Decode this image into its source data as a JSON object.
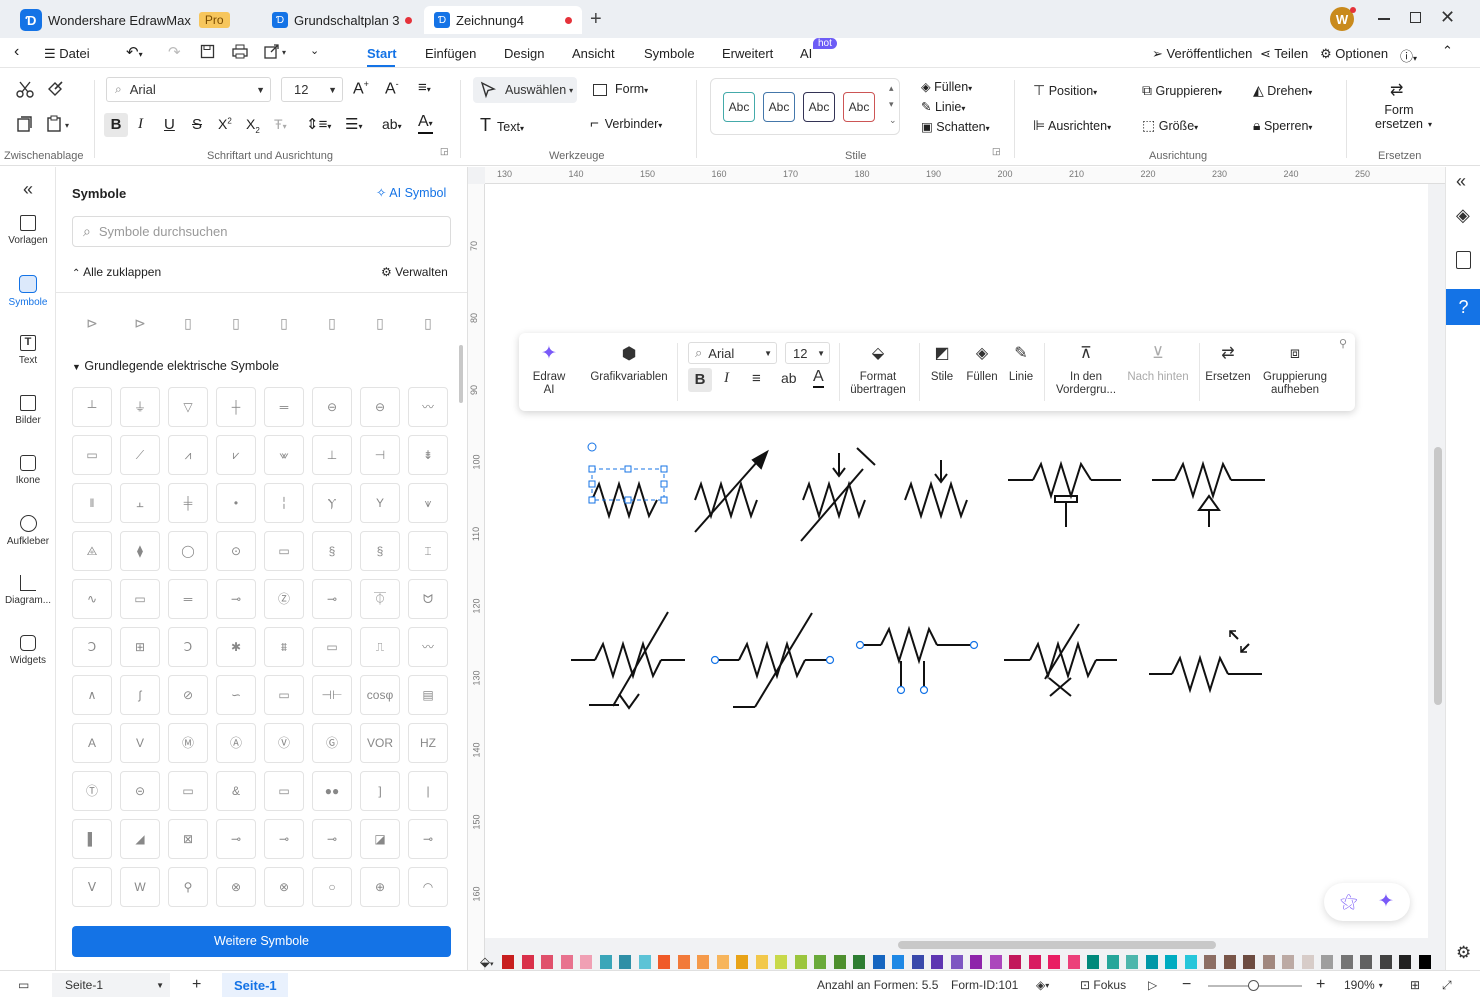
{
  "app": {
    "title": "Wondershare EdrawMax",
    "badge": "Pro",
    "tabs": [
      {
        "label": "Grundschaltplan 3"
      },
      {
        "label": "Zeichnung4"
      }
    ],
    "user_initial": "W"
  },
  "menu": {
    "file": "Datei",
    "tabs": [
      "Start",
      "Einfügen",
      "Design",
      "Ansicht",
      "Symbole",
      "Erweitert",
      "AI"
    ],
    "ai_badge": "hot",
    "publish": "Veröffentlichen",
    "share": "Teilen",
    "options": "Optionen"
  },
  "ribbon": {
    "groups": {
      "clipboard": "Zwischenablage",
      "font": "Schriftart und Ausrichtung",
      "tools": "Werkzeuge",
      "styles": "Stile",
      "align": "Ausrichtung",
      "replace": "Ersetzen"
    },
    "font_name": "Arial",
    "font_size": "12",
    "select": "Auswählen",
    "shape": "Form",
    "text": "Text",
    "connector": "Verbinder",
    "style_samples": [
      "Abc",
      "Abc",
      "Abc",
      "Abc"
    ],
    "fill": "Füllen",
    "line": "Linie",
    "shadow": "Schatten",
    "position": "Position",
    "group": "Gruppieren",
    "rotate": "Drehen",
    "align": "Ausrichten",
    "size": "Größe",
    "lock": "Sperren",
    "replace_shape": [
      "Form",
      "ersetzen"
    ]
  },
  "sidebar": {
    "items": [
      {
        "label": "Vorlagen"
      },
      {
        "label": "Symbole"
      },
      {
        "label": "Text"
      },
      {
        "label": "Bilder"
      },
      {
        "label": "Ikone"
      },
      {
        "label": "Aufkleber"
      },
      {
        "label": "Diagram..."
      },
      {
        "label": "Widgets"
      }
    ]
  },
  "symbols": {
    "title": "Symbole",
    "ai_symbol": "AI Symbol",
    "search_placeholder": "Symbole durchsuchen",
    "collapse_all": "Alle zuklappen",
    "manage": "Verwalten",
    "section": "Grundlegende elektrische Symbole",
    "more": "Weitere Symbole"
  },
  "ruler": {
    "h": [
      "130",
      "140",
      "150",
      "160",
      "170",
      "180",
      "190",
      "200",
      "210",
      "220",
      "230",
      "240",
      "250"
    ],
    "v": [
      "70",
      "80",
      "90",
      "100",
      "110",
      "120",
      "130",
      "140",
      "150",
      "160"
    ]
  },
  "floatbar": {
    "edraw_ai": "Edraw AI",
    "graphic_vars": "Grafikvariablen",
    "font_name": "Arial",
    "font_size": "12",
    "format_transfer": [
      "Format",
      "übertragen"
    ],
    "styles": "Stile",
    "fill": "Füllen",
    "line": "Linie",
    "bring_front": [
      "In den",
      "Vordergru..."
    ],
    "send_back": "Nach hinten",
    "replace": "Ersetzen",
    "ungroup": [
      "Gruppierung",
      "aufheben"
    ]
  },
  "status": {
    "page_tab": "Seite-1",
    "active_page": "Seite-1",
    "shape_count": "Anzahl an Formen: 5.5",
    "shape_id": "Form-ID:101",
    "focus": "Fokus",
    "zoom": "190%"
  },
  "palette": [
    "#c81e1e",
    "#d9304a",
    "#e0506b",
    "#e8728e",
    "#f0a0b4",
    "#3aa6b9",
    "#2f8fa6",
    "#5cc3d6",
    "#f05a28",
    "#f27a3a",
    "#f59a4a",
    "#f7b55c",
    "#e8a317",
    "#f2c84b",
    "#c8d94a",
    "#9bc53d",
    "#6aaa3a",
    "#4e8f2e",
    "#2e7d32",
    "#1565c0",
    "#1e88e5",
    "#3949ab",
    "#5e35b1",
    "#7e57c2",
    "#8e24aa",
    "#ab47bc",
    "#c2185b",
    "#d81b60",
    "#e91e63",
    "#ec407a",
    "#00897b",
    "#26a69a",
    "#4db6ac",
    "#0097a7",
    "#00acc1",
    "#26c6da",
    "#8d6e63",
    "#795548",
    "#6d4c41",
    "#a1887f",
    "#bcaaa4",
    "#d7ccc8",
    "#9e9e9e",
    "#757575",
    "#616161",
    "#424242",
    "#212121",
    "#000000"
  ],
  "colors": {
    "accent": "#1473e6",
    "ai": "#7a5af8"
  }
}
